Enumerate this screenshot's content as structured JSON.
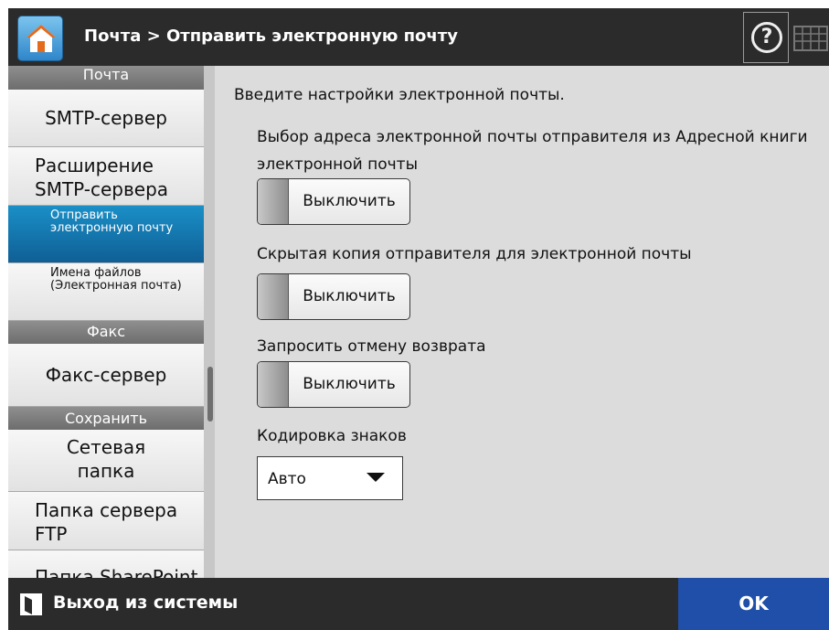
{
  "header": {
    "breadcrumb": "Почта > Отправить электронную почту",
    "help_symbol": "?",
    "icons": [
      "home-icon",
      "help-icon",
      "keyboard-icon"
    ]
  },
  "sidebar": {
    "sections": [
      {
        "title": "Почта",
        "items": [
          {
            "label": "SMTP-сервер"
          },
          {
            "label": "Расширение SMTP-сервера"
          },
          {
            "label": "Отправить электронную почту",
            "active": true
          },
          {
            "label": "Имена файлов (Электронная почта)"
          }
        ]
      },
      {
        "title": "Факс",
        "items": [
          {
            "label": "Факс-сервер"
          }
        ]
      },
      {
        "title": "Сохранить",
        "items": [
          {
            "label": "Сетевая папка"
          },
          {
            "label": "Папка сервера FTP"
          },
          {
            "label": "Папка SharePoint"
          }
        ]
      }
    ]
  },
  "main": {
    "intro": "Введите настройки электронной почты.",
    "settings": [
      {
        "label": "Выбор адреса электронной почты отправителя из Адресной книги электронной почты",
        "value": "Выключить"
      },
      {
        "label": "Скрытая копия отправителя для электронной почты",
        "value": "Выключить"
      },
      {
        "label": "Запросить отмену возврата",
        "value": "Выключить"
      }
    ],
    "encoding": {
      "label": "Кодировка знаков",
      "value": "Авто"
    }
  },
  "footer": {
    "logout_label": "Выход из системы",
    "ok_label": "OK"
  },
  "colors": {
    "header_bg": "#2b2b2b",
    "active_item": "#1a8fc7",
    "ok_button": "#1f4fa8",
    "panel_bg": "#dcdcdc"
  }
}
